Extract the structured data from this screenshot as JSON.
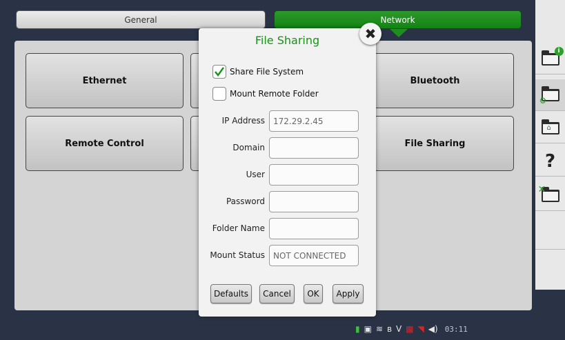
{
  "tabs": {
    "general": "General",
    "network": "Network"
  },
  "tiles": {
    "ethernet": "Ethernet",
    "bluetooth": "Bluetooth",
    "remote_control": "Remote Control",
    "file_sharing": "File Sharing"
  },
  "dialog": {
    "title": "File Sharing",
    "share_file_system": {
      "label": "Share File System",
      "checked": true
    },
    "mount_remote_folder": {
      "label": "Mount Remote Folder",
      "checked": false
    },
    "fields": {
      "ip_address": {
        "label": "IP Address",
        "value": "172.29.2.45"
      },
      "domain": {
        "label": "Domain",
        "value": ""
      },
      "user": {
        "label": "User",
        "value": ""
      },
      "password": {
        "label": "Password",
        "value": ""
      },
      "folder_name": {
        "label": "Folder Name",
        "value": ""
      },
      "mount_status": {
        "label": "Mount Status",
        "value": "NOT CONNECTED"
      }
    },
    "buttons": {
      "defaults": "Defaults",
      "cancel": "Cancel",
      "ok": "OK",
      "apply": "Apply"
    }
  },
  "sidebar": {
    "help": "?"
  },
  "status": {
    "time": "03:11",
    "bluetooth_glyph": "ʙ",
    "v_glyph": "V"
  },
  "colors": {
    "accent_green": "#179317",
    "tab_active": "#1f8d1f",
    "background": "#2a3346"
  },
  "icons": [
    "close-icon",
    "checkmark-icon",
    "info-folder-icon",
    "settings-folder-icon",
    "home-folder-icon",
    "help-icon",
    "tools-folder-icon",
    "battery-plug-icon",
    "wifi-icon",
    "bluetooth-icon",
    "speaker-icon"
  ]
}
